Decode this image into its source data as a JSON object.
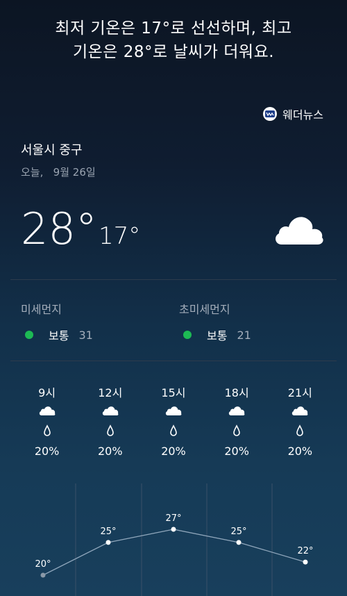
{
  "headline": {
    "line1": "최저 기온은 17°로 선선하며, 최고",
    "line2": "기온은 28°로 날씨가 더워요."
  },
  "source": {
    "name": "웨더뉴스",
    "icon": "weathernews-logo-icon"
  },
  "location": "서울시 중구",
  "date": "오늘,   9월 26일",
  "current": {
    "high": "28°",
    "low": "17°",
    "icon": "cloud-icon"
  },
  "air": [
    {
      "label": "미세먼지",
      "status": "보통",
      "value": "31",
      "color": "#1db954"
    },
    {
      "label": "초미세먼지",
      "status": "보통",
      "value": "21",
      "color": "#1db954"
    }
  ],
  "hourly": [
    {
      "time": "9시",
      "precip": "20%"
    },
    {
      "time": "12시",
      "precip": "20%"
    },
    {
      "time": "15시",
      "precip": "20%"
    },
    {
      "time": "18시",
      "precip": "20%"
    },
    {
      "time": "21시",
      "precip": "20%"
    }
  ],
  "chart_data": {
    "type": "line",
    "x": [
      "9시",
      "12시",
      "15시",
      "18시",
      "21시"
    ],
    "values": [
      20,
      25,
      27,
      25,
      22
    ],
    "labels": [
      "20°",
      "25°",
      "27°",
      "25°",
      "22°"
    ]
  }
}
